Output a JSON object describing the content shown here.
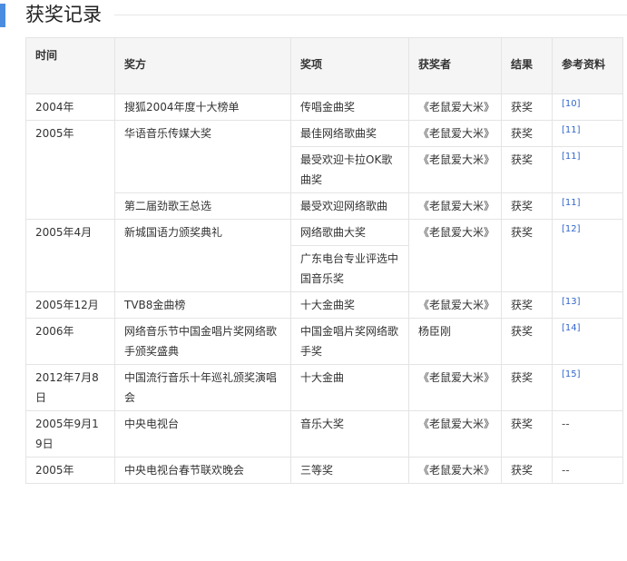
{
  "section": {
    "title": "获奖记录"
  },
  "table": {
    "headers": {
      "time": "时间",
      "awarder": "奖方",
      "award": "奖项",
      "winner": "获奖者",
      "result": "结果",
      "ref": "参考资料"
    },
    "rows": [
      {
        "time": "2004年",
        "awarder": "搜狐2004年度十大榜单",
        "award": "传唱金曲奖",
        "winner": "《老鼠爱大米》",
        "result": "获奖",
        "ref": "[10]"
      },
      {
        "time": "2005年",
        "awarder": "华语音乐传媒大奖",
        "award": "最佳网络歌曲奖",
        "winner": "《老鼠爱大米》",
        "result": "获奖",
        "ref": "[11]"
      },
      {
        "award": "最受欢迎卡拉OK歌曲奖",
        "winner": "《老鼠爱大米》",
        "result": "获奖",
        "ref": "[11]"
      },
      {
        "awarder": "第二届劲歌王总选",
        "award": "最受欢迎网络歌曲",
        "winner": "《老鼠爱大米》",
        "result": "获奖",
        "ref": "[11]"
      },
      {
        "time": "2005年4月",
        "awarder": "新城国语力颁奖典礼",
        "award": "网络歌曲大奖",
        "winner": "《老鼠爱大米》",
        "result": "获奖",
        "ref": "[12]"
      },
      {
        "award": "广东电台专业评选中国音乐奖"
      },
      {
        "time": "2005年12月",
        "awarder": "TVB8金曲榜",
        "award": "十大金曲奖",
        "winner": "《老鼠爱大米》",
        "result": "获奖",
        "ref": "[13]"
      },
      {
        "time": "2006年",
        "awarder": "网络音乐节中国金唱片奖网络歌手颁奖盛典",
        "award": "中国金唱片奖网络歌手奖",
        "winner": "杨臣刚",
        "result": "获奖",
        "ref": "[14]"
      },
      {
        "time": "2012年7月8日",
        "awarder": "中国流行音乐十年巡礼颁奖演唱会",
        "award": "十大金曲",
        "winner": "《老鼠爱大米》",
        "result": "获奖",
        "ref": "[15]"
      },
      {
        "time": "2005年9月19日",
        "awarder": "中央电视台",
        "award": "音乐大奖",
        "winner": "《老鼠爱大米》",
        "result": "获奖",
        "ref": "--"
      },
      {
        "time": "2005年",
        "awarder": "中央电视台春节联欢晚会",
        "award": "三等奖",
        "winner": "《老鼠爱大米》",
        "result": "获奖",
        "ref": "--"
      }
    ]
  }
}
